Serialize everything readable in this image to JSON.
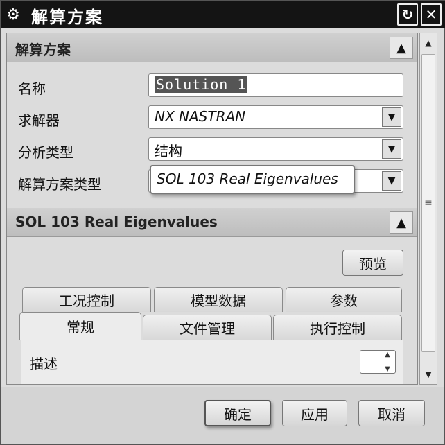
{
  "window": {
    "title": "解算方案",
    "icon": "gear-icon",
    "reset_glyph": "↻",
    "close_glyph": "✕"
  },
  "section1": {
    "title": "解算方案",
    "collapse_glyph": "▲",
    "rows": {
      "name": {
        "label": "名称",
        "value": "Solution 1"
      },
      "solver": {
        "label": "求解器",
        "value": "NX NASTRAN"
      },
      "analysis_type": {
        "label": "分析类型",
        "value": "结构"
      },
      "solution_type": {
        "label": "解算方案类型",
        "value": "SOL 103 Real Eigenvalues"
      }
    },
    "combo_glyph": "▼"
  },
  "section2": {
    "title": "SOL 103 Real Eigenvalues",
    "collapse_glyph": "▲",
    "preview_label": "预览",
    "tabs_row1": [
      "工况控制",
      "模型数据",
      "参数"
    ],
    "tabs_row2": [
      "常规",
      "文件管理",
      "执行控制"
    ],
    "active_tab": "常规",
    "description_label": "描述"
  },
  "scrollbar": {
    "up": "▲",
    "down": "▼",
    "grip": "≡"
  },
  "spinner": {
    "up": "▲",
    "down": "▼"
  },
  "footer": {
    "ok_label": "确定",
    "apply_label": "应用",
    "cancel_label": "取消"
  }
}
